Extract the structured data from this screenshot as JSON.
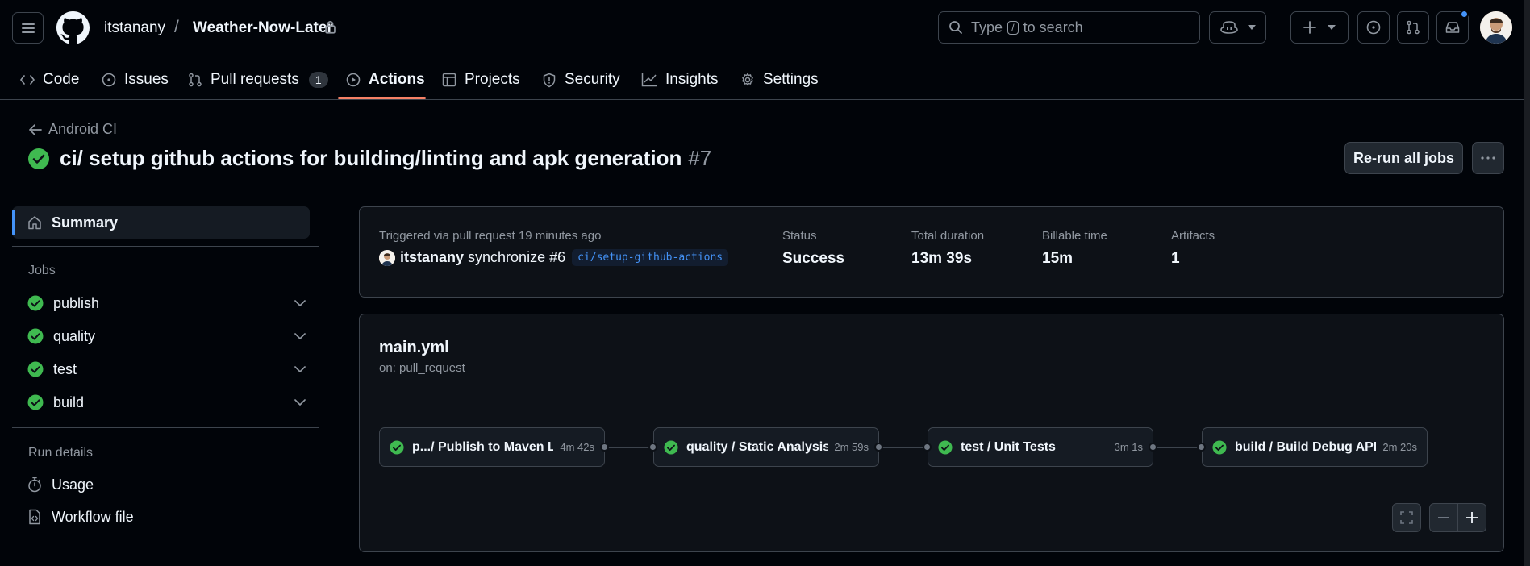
{
  "header": {
    "owner": "itstanany",
    "separator": "/",
    "repo": "Weather-Now-Later",
    "search": {
      "prefix": "Type",
      "key": "/",
      "suffix": "to search"
    }
  },
  "tabs": [
    {
      "label": "Code",
      "icon": "code-icon"
    },
    {
      "label": "Issues",
      "icon": "issue-icon"
    },
    {
      "label": "Pull requests",
      "icon": "pull-request-icon",
      "count": "1"
    },
    {
      "label": "Actions",
      "icon": "play-icon",
      "active": true
    },
    {
      "label": "Projects",
      "icon": "table-icon"
    },
    {
      "label": "Security",
      "icon": "shield-icon"
    },
    {
      "label": "Insights",
      "icon": "graph-icon"
    },
    {
      "label": "Settings",
      "icon": "gear-icon"
    }
  ],
  "page": {
    "back_label": "Android CI",
    "title": "ci/ setup github actions for building/linting and apk generation",
    "run_number": "#7",
    "rerun_label": "Re-run all jobs"
  },
  "sidebar": {
    "summary_label": "Summary",
    "jobs_heading": "Jobs",
    "jobs": [
      {
        "name": "publish",
        "status": "success"
      },
      {
        "name": "quality",
        "status": "success"
      },
      {
        "name": "test",
        "status": "success"
      },
      {
        "name": "build",
        "status": "success"
      }
    ],
    "run_details_heading": "Run details",
    "run_details": [
      {
        "label": "Usage",
        "icon": "stopwatch-icon"
      },
      {
        "label": "Workflow file",
        "icon": "file-code-icon"
      }
    ]
  },
  "summary": {
    "triggered_text": "Triggered via pull request 19 minutes ago",
    "actor": "itstanany",
    "event_text": "synchronize #6",
    "branch": "ci/setup-github-actions",
    "metrics": [
      {
        "label": "Status",
        "value": "Success"
      },
      {
        "label": "Total duration",
        "value": "13m 39s"
      },
      {
        "label": "Billable time",
        "value": "15m"
      },
      {
        "label": "Artifacts",
        "value": "1"
      }
    ]
  },
  "workflow": {
    "file": "main.yml",
    "trigger": "on: pull_request",
    "jobs": [
      {
        "label": "p.../ Publish to Maven L...",
        "time": "4m 42s"
      },
      {
        "label": "quality / Static Analysis",
        "time": "2m 59s"
      },
      {
        "label": "test / Unit Tests",
        "time": "3m 1s"
      },
      {
        "label": "build / Build Debug APK",
        "time": "2m 20s"
      }
    ]
  },
  "colors": {
    "success": "#3fb950",
    "accent_underline": "#f78166",
    "link_blue": "#4493f8"
  }
}
